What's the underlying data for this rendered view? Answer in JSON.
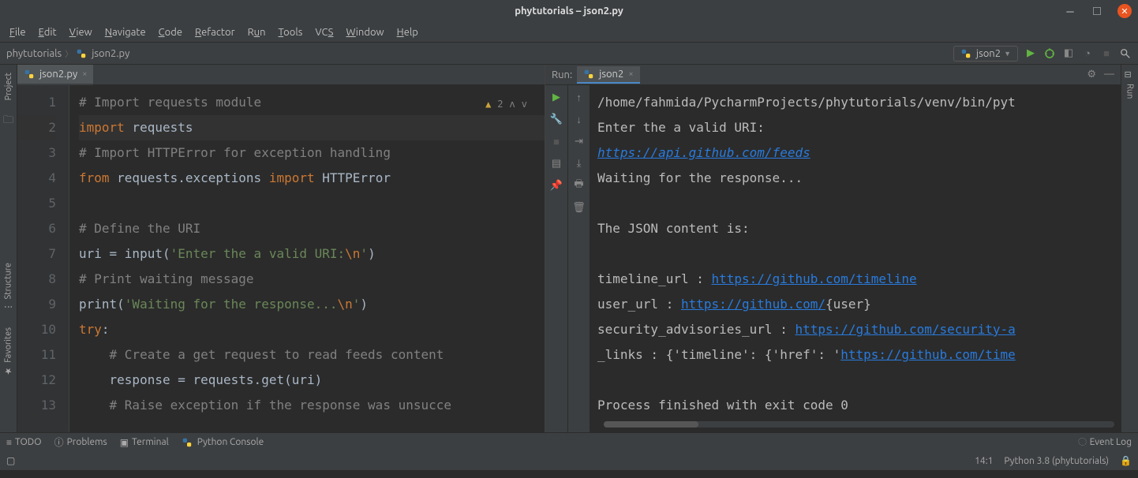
{
  "window": {
    "title": "phytutorials – json2.py"
  },
  "menu": {
    "file": "File",
    "edit": "Edit",
    "view": "View",
    "navigate": "Navigate",
    "code": "Code",
    "refactor": "Refactor",
    "run": "Run",
    "tools": "Tools",
    "vcs": "VCS",
    "window": "Window",
    "help": "Help"
  },
  "breadcrumb": {
    "project": "phytutorials",
    "file": "json2.py"
  },
  "runconfig": {
    "name": "json2"
  },
  "editor": {
    "tab": "json2.py",
    "warn_count": "2",
    "lines": {
      "l1": "# Import requests module",
      "l2a": "import",
      "l2b": " requests",
      "l3": "# Import HTTPError for exception handling",
      "l4a": "from",
      "l4b": " requests.exceptions ",
      "l4c": "import",
      "l4d": " HTTPError",
      "l5": "",
      "l6": "# Define the URI",
      "l7a": "uri = input(",
      "l7b": "'Enter the a valid URI:",
      "l7c": "\\n",
      "l7d": "'",
      "l7e": ")",
      "l8": "# Print waiting message",
      "l9a": "print(",
      "l9b": "'Waiting for the response...",
      "l9c": "\\n",
      "l9d": "'",
      "l9e": ")",
      "l10a": "try",
      "l10b": ":",
      "l11": "    # Create a get request to read feeds content",
      "l12": "    response = requests.get(uri)",
      "l13": "    # Raise exception if the response was unsucce"
    }
  },
  "run": {
    "label": "Run:",
    "tab": "json2",
    "out": {
      "l1": "/home/fahmida/PycharmProjects/phytutorials/venv/bin/pyt",
      "l2": "Enter the a valid URI:",
      "l3": "https://api.github.com/feeds",
      "l4": "Waiting for the response...",
      "l5": "",
      "l6": "The JSON content is:",
      "l7": "",
      "l8a": "timeline_url : ",
      "l8b": "https://github.com/timeline",
      "l9a": "user_url : ",
      "l9b": "https://github.com/",
      "l9c": "{user}",
      "l10a": "security_advisories_url : ",
      "l10b": "https://github.com/security-a",
      "l11a": "_links : {'timeline': {'href': '",
      "l11b": "https://github.com/time",
      "l12": "",
      "l13": "Process finished with exit code 0"
    }
  },
  "left_tools": {
    "project": "Project",
    "structure": "Structure",
    "favorites": "Favorites"
  },
  "right_tools": {
    "run": "Run"
  },
  "bottom": {
    "todo": "TODO",
    "problems": "Problems",
    "terminal": "Terminal",
    "pyconsole": "Python Console",
    "eventlog": "Event Log"
  },
  "status": {
    "pos": "14:1",
    "python": "Python 3.8 (phytutorials)"
  }
}
